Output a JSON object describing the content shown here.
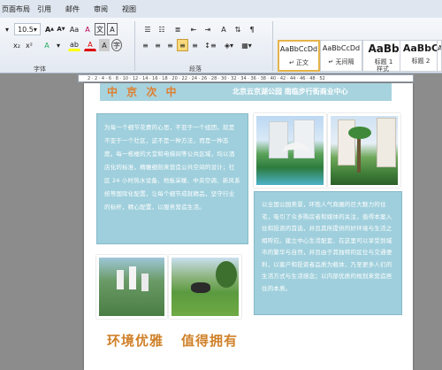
{
  "tabs": [
    "页面布局",
    "引用",
    "邮件",
    "审阅",
    "视图"
  ],
  "font": {
    "size": "10.5",
    "grow_icon": "font-grow-icon",
    "shrink_icon": "font-shrink-icon",
    "clear_icon": "clear-format-icon",
    "wen_icon": "phonetic-guide-icon",
    "a_icon": "char-border-icon"
  },
  "groups": {
    "font": "字体",
    "paragraph": "段落",
    "styles": "样式"
  },
  "styles": [
    {
      "sample": "AaBbCcDd",
      "name": "↵ 正文"
    },
    {
      "sample": "AaBbCcDd",
      "name": "↵ 无间隔"
    },
    {
      "sample": "AaBb",
      "name": "标题 1"
    },
    {
      "sample": "AaBbC",
      "name": "标题 2"
    },
    {
      "sample": "A",
      "name": "标"
    }
  ],
  "ruler_numbers": "2 · 2 · 4 · 6 · 8 · 10 · 12 · 14 · 16 · 18 · 20 · 22 · 24 · 26 · 28 · 30 · 32 · 34 · 36 · 38 · 40 · 42 · 44 · 46 · 48 · 52",
  "doc": {
    "header_left": "中 京 次 中",
    "header_right": "北京云京湖公园 南临步行街商业中心",
    "left_text": "为每一个细节花费的心思，不亚于一个组团，就是不亚于一个社区，这不是一种方法，而是一种态度。每一栋楼的大堂和电梯间等公共区域，均以酒店化的标准，精雕细刻来营造公共空间的设计；社区 24 小时热水设备、地板采暖、中央空调、新风系统等国际化配置，让每个细节成就精品，坚守行业的标杆，精心配置，以服务营造生活。",
    "right_text": "以全国公园美景，环抱人气商圈的巨大魅力的住宅，吸引了众多购房者和媒体的关注，值得本案入住和投资的首选，并且其所提供的好环境与生活之相呼应。建立中心生活配套、在这里可以享受到城市的繁华与自然，并且由于其独特的区位与交通便利，以客户和投资者品质为载体，乃至更多人们的生活方式与生活感念；以内部优质的规划来营造居住的本质。",
    "slogan1": "环境优雅",
    "slogan2": "值得拥有",
    "photo_labels": {
      "p1": "resort-pool-photo",
      "p2": "palm-towers-photo",
      "p3": "aerial-community-photo",
      "p4": "lawn-sculpture-photo"
    }
  },
  "colors": {
    "panel": "#9fcfdc",
    "slogan": "#d0812a",
    "header_band": "#9fcfdc"
  }
}
